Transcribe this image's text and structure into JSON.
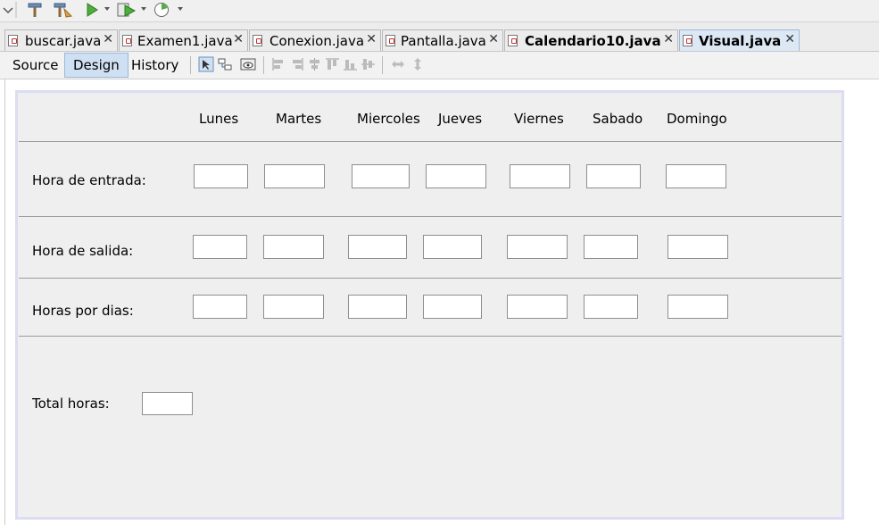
{
  "toolbar": {
    "icons": [
      "hammer-icon",
      "clean-build-icon",
      "run-icon",
      "debug-icon",
      "profile-icon"
    ]
  },
  "tabs": [
    {
      "label": "buscar.java",
      "bold": false,
      "active": false
    },
    {
      "label": "Examen1.java",
      "bold": false,
      "active": false
    },
    {
      "label": "Conexion.java",
      "bold": false,
      "active": false
    },
    {
      "label": "Pantalla.java",
      "bold": false,
      "active": false
    },
    {
      "label": "Calendario10.java",
      "bold": true,
      "active": false
    },
    {
      "label": "Visual.java",
      "bold": true,
      "active": true
    }
  ],
  "close_glyph": "✕",
  "views": {
    "source": "Source",
    "design": "Design",
    "history": "History",
    "selected": "Design"
  },
  "form": {
    "days": [
      "Lunes",
      "Martes",
      "Miercoles",
      "Jueves",
      "Viernes",
      "Sabado",
      "Domingo"
    ],
    "rows": [
      {
        "label": "Hora de entrada:",
        "values": [
          "",
          "",
          "",
          "",
          "",
          "",
          ""
        ]
      },
      {
        "label": "Hora de salida:",
        "values": [
          "",
          "",
          "",
          "",
          "",
          "",
          ""
        ]
      },
      {
        "label": "Horas por dias:",
        "values": [
          "",
          "",
          "",
          "",
          "",
          "",
          ""
        ]
      }
    ],
    "total_label": "Total horas:",
    "total_value": ""
  },
  "colors": {
    "accent_tab": "#dde8f5",
    "selected_view": "#cfe0f3",
    "form_bg": "#efefef",
    "form_border": "#dcdcf2"
  }
}
